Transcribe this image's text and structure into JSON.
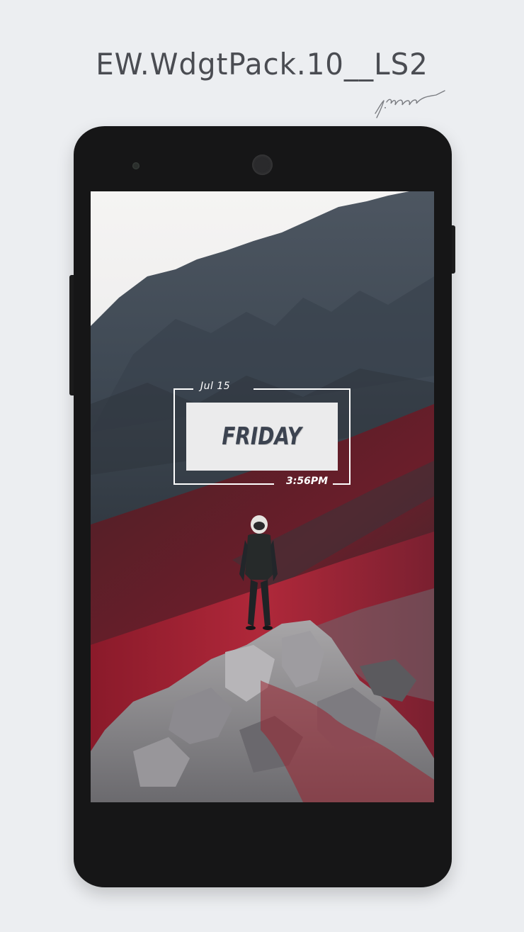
{
  "header": {
    "title": "EW.WdgtPack.10__LS2",
    "signature": "y.nam"
  },
  "widget": {
    "date": "Jul 15",
    "day": "FRIDAY",
    "time": "3:56PM"
  },
  "colors": {
    "page_bg": "#eceef1",
    "phone_body": "#161617",
    "day_box_bg": "#ebebec",
    "day_text": "#3c4350",
    "frame_line": "#ffffff"
  },
  "wallpaper": {
    "subject": "astronaut-on-rock-icon"
  }
}
